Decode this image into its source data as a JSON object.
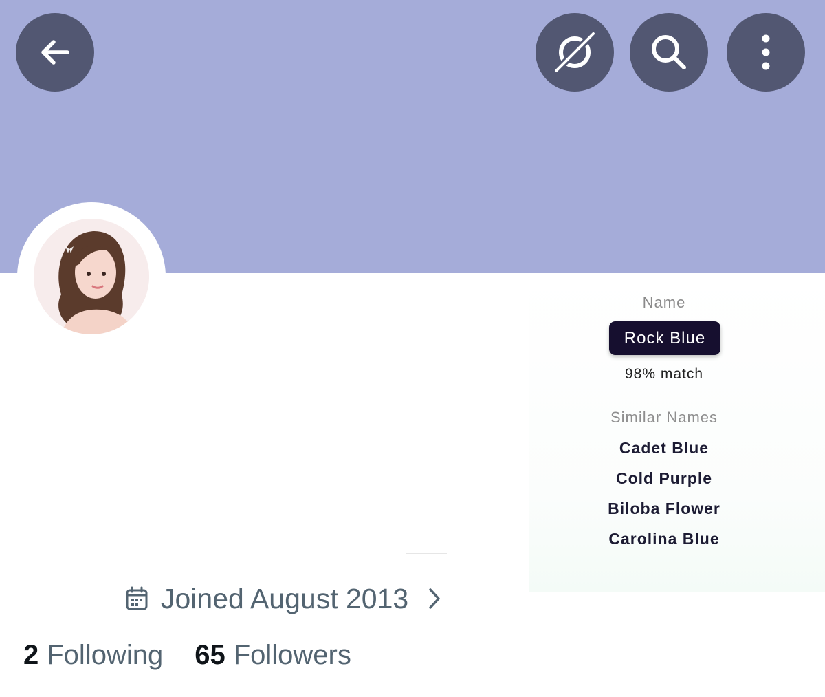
{
  "header": {
    "back_icon": "arrow-left-icon",
    "hide_icon": "eye-slash-icon",
    "search_icon": "search-icon",
    "more_icon": "more-vertical-icon",
    "banner_color": "#a5acd9"
  },
  "profile": {
    "joined": "Joined August 2013",
    "following_count": "2",
    "following_label": "Following",
    "followers_count": "65",
    "followers_label": "Followers"
  },
  "color_panel": {
    "name_label": "Name",
    "name_value": "Rock Blue",
    "match": "98% match",
    "similar_label": "Similar Names",
    "similar": [
      "Cadet Blue",
      "Cold Purple",
      "Biloba Flower",
      "Carolina Blue"
    ]
  }
}
